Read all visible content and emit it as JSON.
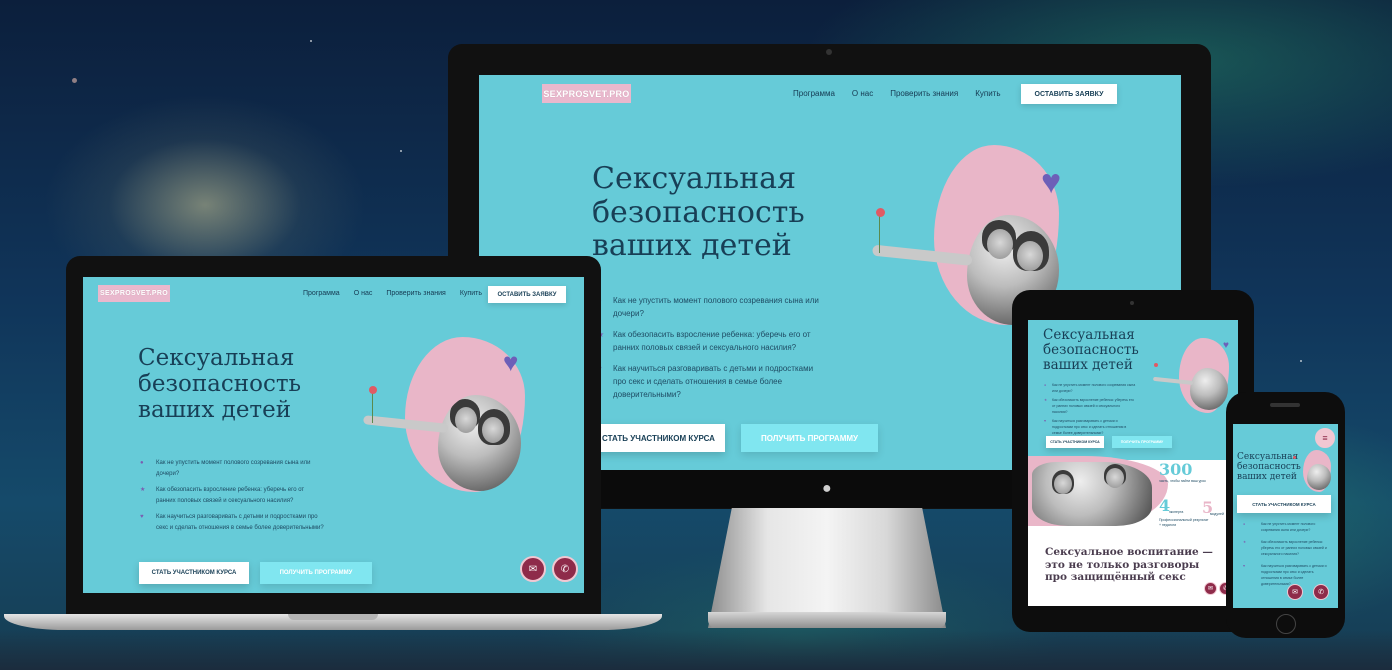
{
  "site": {
    "logo": "SEXPROSVET.PRO",
    "nav": [
      "Программа",
      "О нас",
      "Проверить знания",
      "Купить"
    ],
    "cta": "ОСТАВИТЬ ЗАЯВКУ",
    "title_lines": [
      "Сексуальная",
      "безопасность",
      "ваших детей"
    ],
    "bullets": [
      "Как не упустить момент полового созревания сына или дочери?",
      "Как обезопасить взросление ребенка: уберечь его от ранних половых связей и сексуального насилия?",
      "Как научиться разговаривать с детьми и подростками про секс и сделать отношения в семье более доверительными?"
    ],
    "btn_join": "СТАТЬ УЧАСТНИКОМ КУРСА",
    "btn_program": "ПОЛУЧИТЬ ПРОГРАММУ"
  },
  "tablet": {
    "stats": [
      {
        "number": "300",
        "text": "часть, чтобы найти ваш урок"
      },
      {
        "number": "4",
        "text": "эксперта"
      },
      {
        "number": "5",
        "text": "модулей"
      }
    ],
    "stat_note": "Профессиональный результат + педагоги",
    "section_title_lines": [
      "Сексуальное воспитание —",
      "это не только разговоры",
      "про защищённый секс"
    ]
  },
  "colors": {
    "site_bg": "#66cbd8",
    "logo_bg": "#e9b8cd",
    "blob": "#e9b6c8",
    "title": "#183f56",
    "round_button": "#8e2b4a"
  },
  "icons": {
    "bullet_1": "drop-icon",
    "bullet_2": "star-icon",
    "bullet_3": "heart-icon",
    "float_1": "chat-icon",
    "float_2": "phone-icon",
    "mobile_menu": "hamburger-icon",
    "imac_logo": "apple-icon"
  }
}
